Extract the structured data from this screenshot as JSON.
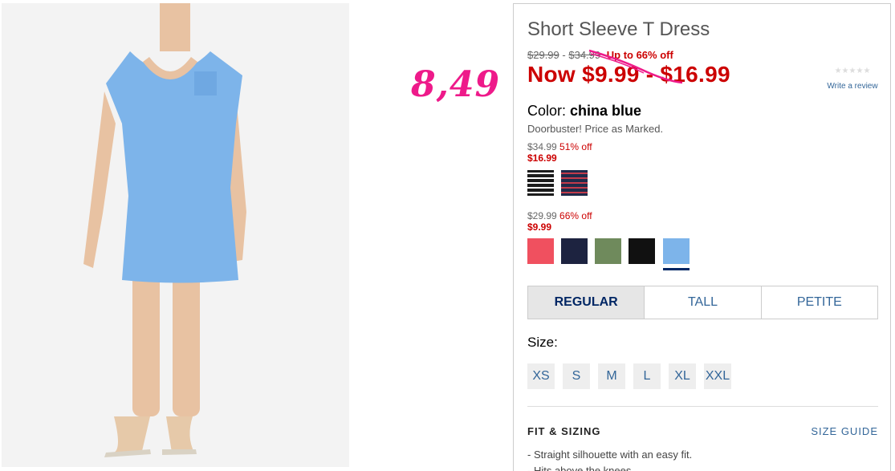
{
  "annotation": {
    "handwritten_price": "8,49"
  },
  "product": {
    "title": "Short Sleeve T Dress",
    "price_was_low": "$29.99",
    "price_separator": "-",
    "price_was_high": "$34.99",
    "discount_text": "Up to 66% off",
    "now_price": "Now $9.99 - $16.99",
    "rating_stars": "★★★★★",
    "write_review": "Write a review",
    "color_label": "Color:",
    "color_value": "china blue",
    "promo_text": "Doorbuster! Price as Marked."
  },
  "price_groups": [
    {
      "original": "$34.99",
      "discount": "51% off",
      "sale": "$16.99",
      "swatches": [
        {
          "name": "black-white-stripe",
          "color": "#1c1c1c",
          "stripe": "#ffffff"
        },
        {
          "name": "navy-red-stripe",
          "color": "#1f2a4a",
          "stripe": "#c23b4b"
        }
      ]
    },
    {
      "original": "$29.99",
      "discount": "66% off",
      "sale": "$9.99",
      "swatches": [
        {
          "name": "coral",
          "color": "#f0505f"
        },
        {
          "name": "navy",
          "color": "#1d2340"
        },
        {
          "name": "olive-green",
          "color": "#6f8a5c"
        },
        {
          "name": "black",
          "color": "#111111"
        },
        {
          "name": "china-blue",
          "color": "#7db4ea",
          "selected": true
        }
      ]
    }
  ],
  "fit_tabs": [
    {
      "label": "REGULAR",
      "active": true
    },
    {
      "label": "TALL",
      "active": false
    },
    {
      "label": "PETITE",
      "active": false
    }
  ],
  "size_label": "Size:",
  "sizes": [
    "XS",
    "S",
    "M",
    "L",
    "XL",
    "XXL"
  ],
  "fit_section": {
    "heading": "FIT & SIZING",
    "size_guide": "SIZE GUIDE",
    "bullets": [
      "Straight silhouette with an easy fit.",
      "Hits above the knees."
    ]
  },
  "colors": {
    "sale_red": "#cc0000",
    "link_blue": "#336699",
    "annotation_pink": "#ee1a8a",
    "dress_blue": "#7db4ea"
  }
}
